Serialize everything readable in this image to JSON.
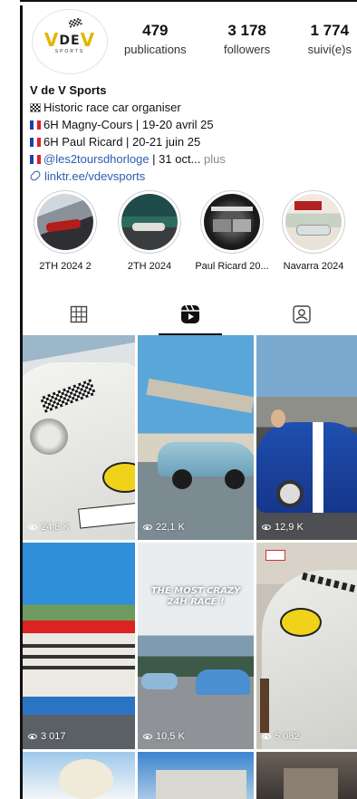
{
  "profile": {
    "logo_text": "VDEV",
    "logo_sub": "SPORTS",
    "stats": [
      {
        "value": "479",
        "label": "publications"
      },
      {
        "value": "3 178",
        "label": "followers"
      },
      {
        "value": "1 774",
        "label": "suivi(e)s"
      }
    ]
  },
  "bio": {
    "name": "V de V Sports",
    "line1": "Historic race car organiser",
    "line2": "6H Magny-Cours | 19-20 avril 25",
    "line3": "6H Paul Ricard | 20-21 juin 25",
    "mention": "@les2toursdhorloge",
    "line4_rest": " | 31 oct...",
    "more": " plus",
    "link": "linktr.ee/vdevsports"
  },
  "highlights": [
    {
      "label": "2TH 2024 2"
    },
    {
      "label": "2TH 2024"
    },
    {
      "label": "Paul Ricard 20..."
    },
    {
      "label": "Navarra 2024"
    }
  ],
  "grid": {
    "overlay_text": "THE MOST CRAZY 24H RACE !",
    "views": [
      "24,8 K",
      "22,1 K",
      "12,9 K",
      "3 017",
      "10,5 K",
      "5 082"
    ]
  },
  "colors": {
    "link": "#2b5db0",
    "logo_yellow": "#e3b505"
  }
}
